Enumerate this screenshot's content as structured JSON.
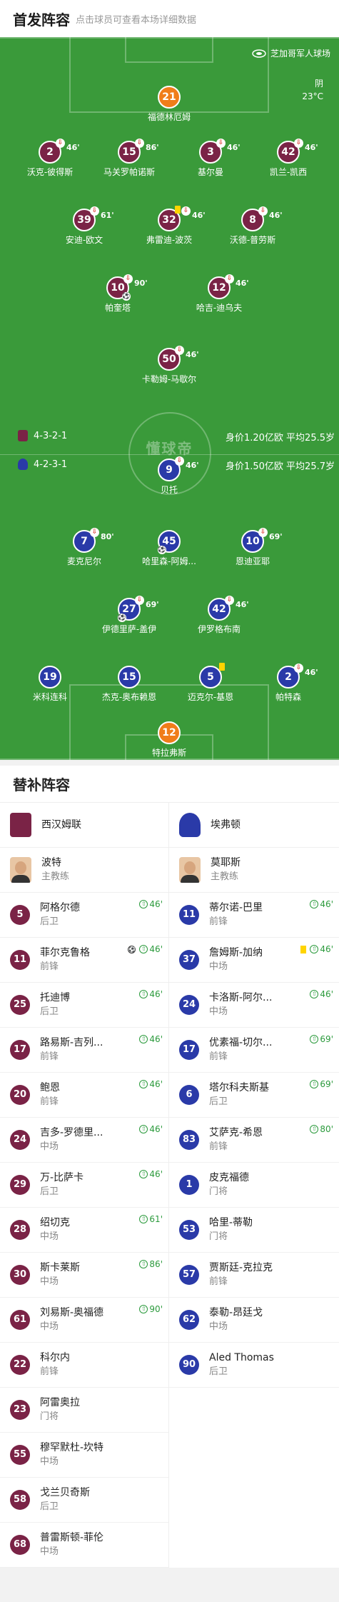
{
  "header": {
    "title": "首发阵容",
    "subtitle": "点击球员可查看本场详细数据"
  },
  "pitch": {
    "stadium": "芝加哥军人球场",
    "weather_desc": "阴",
    "weather_temp": "23°C",
    "watermark": "懂球帝",
    "home_formation": "4-3-2-1",
    "home_value": "身价1.20亿欧",
    "home_age": "平均25.5岁",
    "away_formation": "4-2-3-1",
    "away_value": "身价1.50亿欧",
    "away_age": "平均25.7岁"
  },
  "home_lineup": [
    {
      "num": "21",
      "name": "福德林厄姆",
      "sub": "",
      "gk": true
    },
    {
      "num": "2",
      "name": "沃克-彼得斯",
      "sub": "46'"
    },
    {
      "num": "15",
      "name": "马关罗帕诺斯",
      "sub": "86'"
    },
    {
      "num": "3",
      "name": "基尔曼",
      "sub": "46'"
    },
    {
      "num": "42",
      "name": "凯兰-凯西",
      "sub": "46'"
    },
    {
      "num": "39",
      "name": "安迪-欧文",
      "sub": "61'"
    },
    {
      "num": "32",
      "name": "弗雷迪-波茨",
      "sub": "46'"
    },
    {
      "num": "8",
      "name": "沃德-普劳斯",
      "sub": "46'"
    },
    {
      "num": "10",
      "name": "帕奎塔",
      "sub": "90'"
    },
    {
      "num": "12",
      "name": "哈吉-迪乌夫",
      "sub": "46'"
    },
    {
      "num": "50",
      "name": "卡勒姆-马歇尔",
      "sub": "46'"
    }
  ],
  "away_lineup": [
    {
      "num": "9",
      "name": "贝托",
      "sub": "46'"
    },
    {
      "num": "7",
      "name": "麦克尼尔",
      "sub": "80'"
    },
    {
      "num": "45",
      "name": "哈里森-阿姆...",
      "sub": ""
    },
    {
      "num": "10",
      "name": "恩迪亚耶",
      "sub": "69'"
    },
    {
      "num": "27",
      "name": "伊德里萨-盖伊",
      "sub": "69'"
    },
    {
      "num": "42",
      "name": "伊罗格布南",
      "sub": "46'"
    },
    {
      "num": "19",
      "name": "米科连科",
      "sub": ""
    },
    {
      "num": "15",
      "name": "杰克-奥布赖恩",
      "sub": ""
    },
    {
      "num": "5",
      "name": "迈克尔-基恩",
      "sub": ""
    },
    {
      "num": "2",
      "name": "帕特森",
      "sub": "46'"
    },
    {
      "num": "12",
      "name": "特拉弗斯",
      "sub": "",
      "gk": true
    }
  ],
  "subs": {
    "title": "替补阵容",
    "home_team": "西汉姆联",
    "away_team": "埃弗顿",
    "home_coach": {
      "name": "波特",
      "role": "主教练"
    },
    "away_coach": {
      "name": "莫耶斯",
      "role": "主教练"
    },
    "home": [
      {
        "num": "5",
        "name": "阿格尔德",
        "pos": "后卫",
        "min": "46'"
      },
      {
        "num": "11",
        "name": "菲尔克鲁格",
        "pos": "前锋",
        "min": "46'"
      },
      {
        "num": "25",
        "name": "托迪博",
        "pos": "后卫",
        "min": "46'"
      },
      {
        "num": "17",
        "name": "路易斯-吉列...",
        "pos": "前锋",
        "min": "46'"
      },
      {
        "num": "20",
        "name": "鲍恩",
        "pos": "前锋",
        "min": "46'"
      },
      {
        "num": "24",
        "name": "吉多-罗德里...",
        "pos": "中场",
        "min": "46'"
      },
      {
        "num": "29",
        "name": "万-比萨卡",
        "pos": "后卫",
        "min": "46'"
      },
      {
        "num": "28",
        "name": "绍切克",
        "pos": "中场",
        "min": "61'"
      },
      {
        "num": "30",
        "name": "斯卡莱斯",
        "pos": "中场",
        "min": "86'"
      },
      {
        "num": "61",
        "name": "刘易斯-奥福德",
        "pos": "中场",
        "min": "90'"
      },
      {
        "num": "22",
        "name": "科尔内",
        "pos": "前锋",
        "min": ""
      },
      {
        "num": "23",
        "name": "阿雷奥拉",
        "pos": "门将",
        "min": ""
      },
      {
        "num": "55",
        "name": "穆罕默杜-坎特",
        "pos": "中场",
        "min": ""
      },
      {
        "num": "58",
        "name": "戈兰贝奇斯",
        "pos": "后卫",
        "min": ""
      },
      {
        "num": "68",
        "name": "普雷斯顿-菲伦",
        "pos": "中场",
        "min": ""
      }
    ],
    "away": [
      {
        "num": "11",
        "name": "蒂尔诺-巴里",
        "pos": "前锋",
        "min": "46'"
      },
      {
        "num": "37",
        "name": "詹姆斯-加纳",
        "pos": "中场",
        "min": "46'"
      },
      {
        "num": "24",
        "name": "卡洛斯-阿尔...",
        "pos": "中场",
        "min": "46'"
      },
      {
        "num": "17",
        "name": "优素福-切尔...",
        "pos": "前锋",
        "min": "69'"
      },
      {
        "num": "6",
        "name": "塔尔科夫斯基",
        "pos": "后卫",
        "min": "69'"
      },
      {
        "num": "83",
        "name": "艾萨克-希恩",
        "pos": "前锋",
        "min": "80'"
      },
      {
        "num": "1",
        "name": "皮克福德",
        "pos": "门将",
        "min": ""
      },
      {
        "num": "53",
        "name": "哈里-蒂勒",
        "pos": "门将",
        "min": ""
      },
      {
        "num": "57",
        "name": "贾斯廷-克拉克",
        "pos": "前锋",
        "min": ""
      },
      {
        "num": "62",
        "name": "泰勒-昂廷戈",
        "pos": "中场",
        "min": ""
      },
      {
        "num": "90",
        "name": "Aled Thomas",
        "pos": "后卫",
        "min": ""
      }
    ]
  },
  "colors": {
    "home": "#7a2346",
    "away": "#2a3aa8",
    "gk": "#f07d1a",
    "pitch": "#3a9a3a"
  }
}
